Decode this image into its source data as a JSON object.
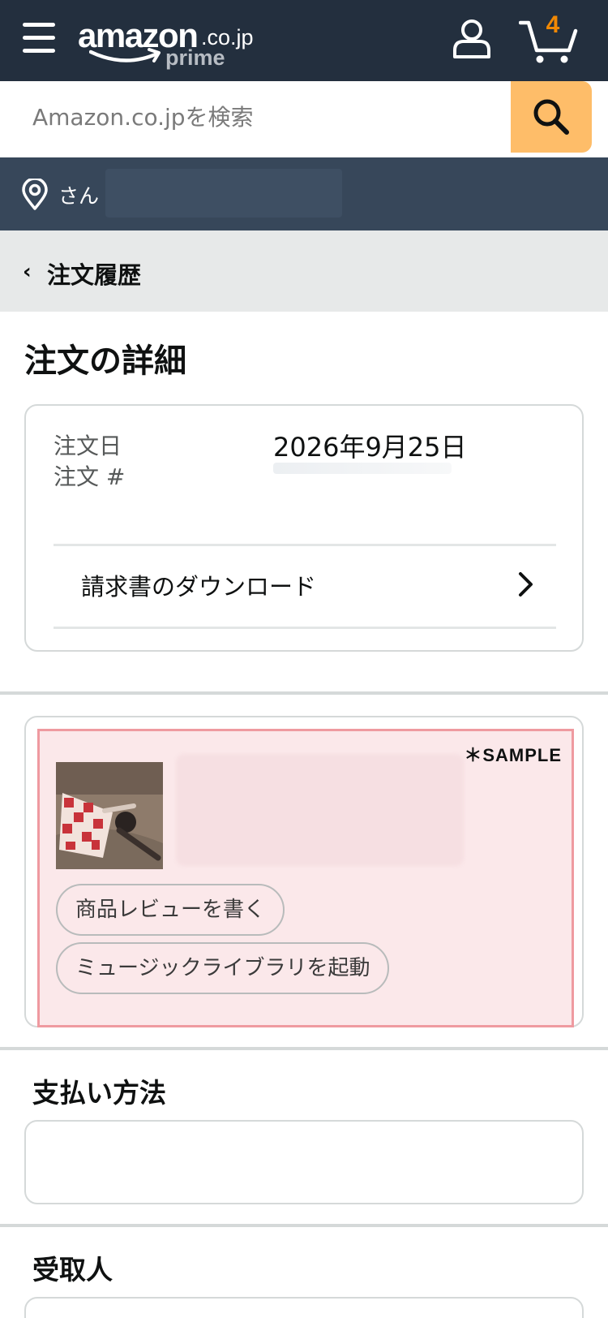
{
  "header": {
    "logo_text": "amazon",
    "logo_tld": ".co.jp",
    "logo_prime": "prime",
    "cart_count": "4",
    "icons": [
      "hamburger-menu-icon",
      "account-icon",
      "cart-icon",
      "search-icon",
      "location-pin-icon"
    ]
  },
  "search": {
    "placeholder": "Amazon.co.jpを検索"
  },
  "location": {
    "text": "さん"
  },
  "breadcrumb": {
    "chevron": "‹",
    "label": "注文履歴"
  },
  "page": {
    "title": "注文の詳細"
  },
  "order": {
    "date_label": "注文日",
    "date_value": "2026年9月25日",
    "number_label": "注文 #",
    "invoice_link": "請求書のダウンロード"
  },
  "item": {
    "sample_label": "＊SAMPLE",
    "review_button": "商品レビューを書く",
    "library_button": "ミュージックライブラリを起動"
  },
  "sections": {
    "payment_heading": "支払い方法",
    "recipient_heading": "受取人"
  },
  "colors": {
    "header_bg": "#232f3e",
    "location_bg": "#37475a",
    "search_button": "#febd69",
    "cart_count": "#f08804",
    "sample_border": "#ef9aa0",
    "sample_fill": "#fbe8ea"
  }
}
